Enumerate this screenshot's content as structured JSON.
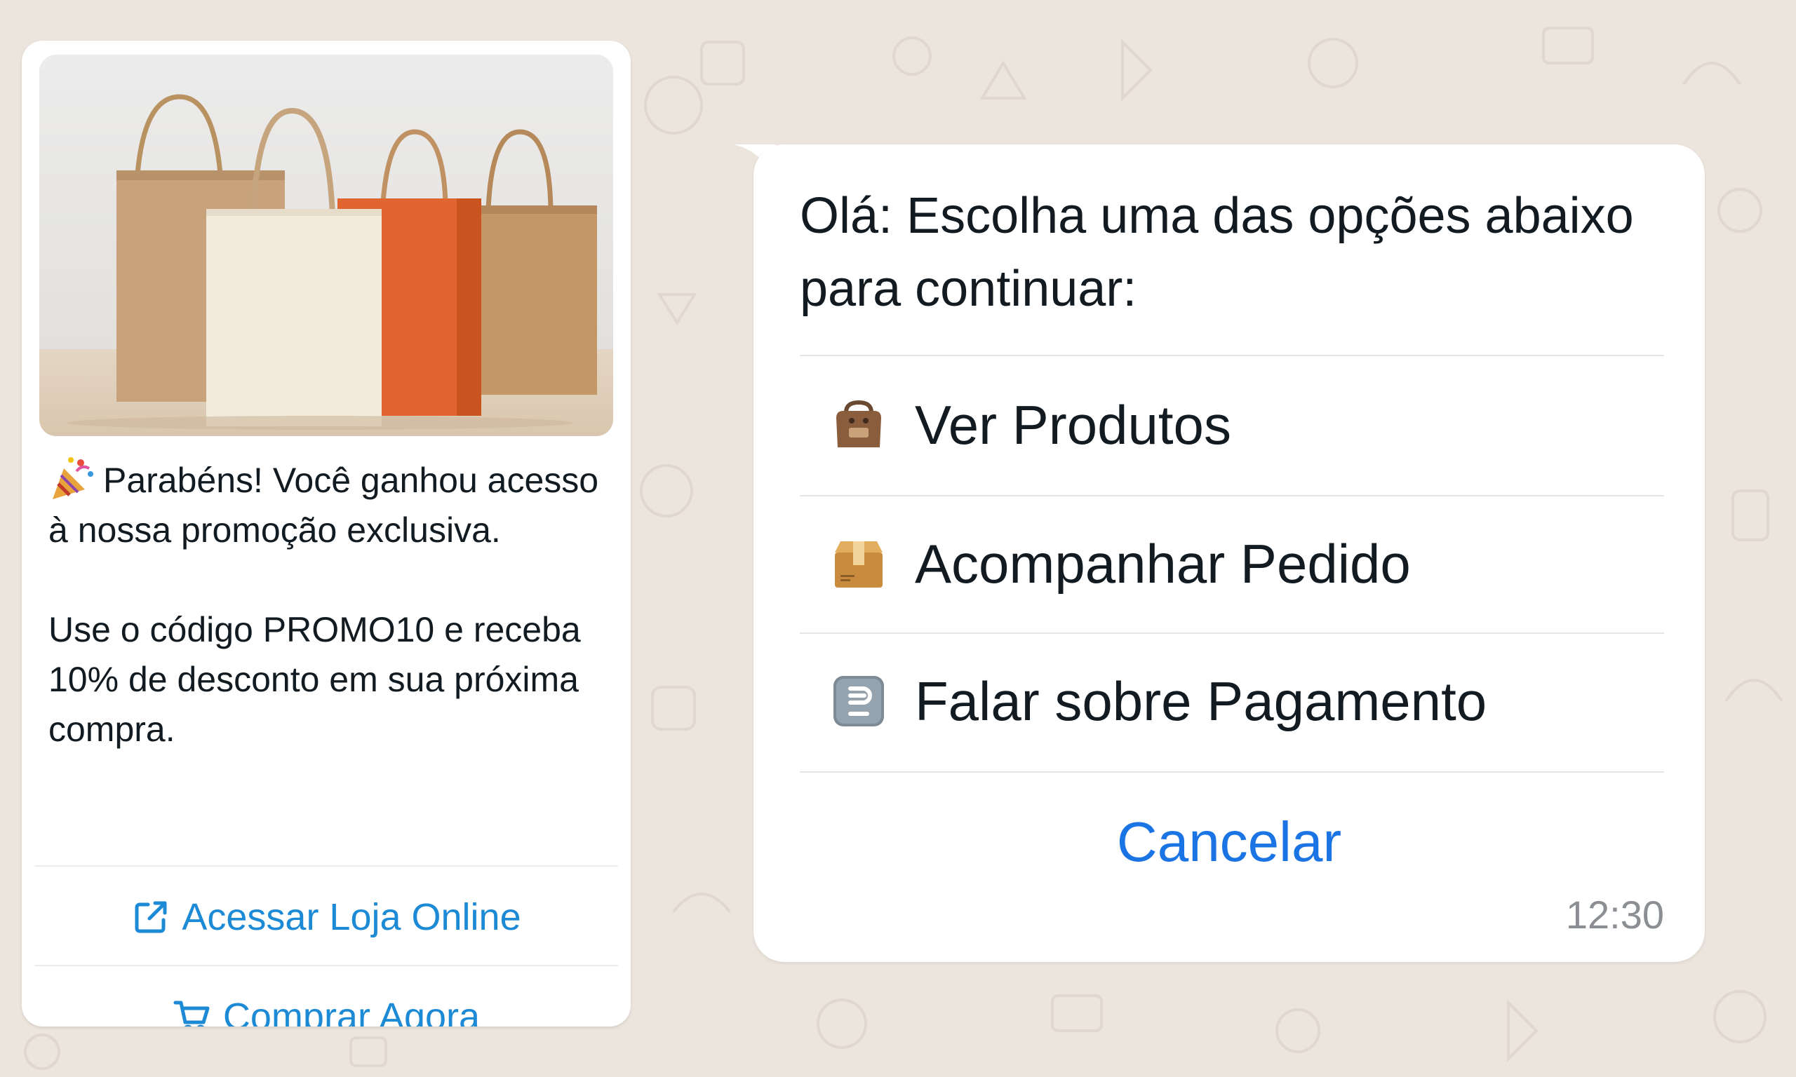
{
  "promo_card": {
    "paragraph_1": "Parabéns! Você ganhou acesso à nossa promoção exclusiva.",
    "paragraph_2": "Use o código PROMO10 e receba 10% de desconto em sua próxima compra.",
    "buttons": [
      {
        "label": "Acessar Loja Online",
        "icon": "external-link-icon"
      },
      {
        "label": "Comprar Agora",
        "icon": "cart-icon"
      }
    ]
  },
  "menu_bubble": {
    "prompt": "Olá: Escolha uma das opções abaixo para continuar:",
    "options": [
      {
        "label": "Ver Produtos",
        "icon": "shopping-bag-icon"
      },
      {
        "label": "Acompanhar Pedido",
        "icon": "package-icon"
      },
      {
        "label": "Falar sobre Pagamento",
        "icon": "payment-icon"
      }
    ],
    "cancel_label": "Cancelar",
    "timestamp": "12:30"
  },
  "colors": {
    "background": "#ece5dd",
    "bubble": "#ffffff",
    "link_blue": "#1d8ad6",
    "cancel_blue": "#1b74e4",
    "text": "#111b21",
    "timestamp": "#8b8f93"
  }
}
